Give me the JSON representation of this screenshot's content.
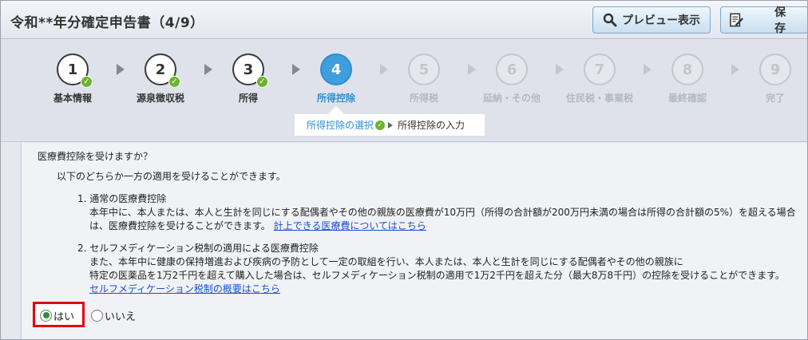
{
  "header": {
    "title": "令和**年分確定申告書（4/9）",
    "preview_label": "プレビュー表示",
    "save_label": "保存"
  },
  "steps": [
    {
      "number": "1",
      "label": "基本情報",
      "state": "done"
    },
    {
      "number": "2",
      "label": "源泉徴収税",
      "state": "done"
    },
    {
      "number": "3",
      "label": "所得",
      "state": "done"
    },
    {
      "number": "4",
      "label": "所得控除",
      "state": "current"
    },
    {
      "number": "5",
      "label": "所得税",
      "state": "future"
    },
    {
      "number": "6",
      "label": "延納・その他",
      "state": "future"
    },
    {
      "number": "7",
      "label": "住民税・事業税",
      "state": "future"
    },
    {
      "number": "8",
      "label": "最終確認",
      "state": "future"
    },
    {
      "number": "9",
      "label": "完了",
      "state": "future"
    }
  ],
  "substeps": {
    "done": "所得控除の選択",
    "current": "所得控除の入力"
  },
  "content": {
    "question": "医療費控除を受けますか？",
    "intro": "以下のどちらか一方の適用を受けることができます。",
    "option1": {
      "title": "1. 通常の医療費控除",
      "body": "本年中に、本人または、本人と生計を同じにする配偶者やその他の親族の医療費が10万円（所得の合計額が200万円未満の場合は所得の合計額の5%）を超える場合は、医療費控除を受けることができます。",
      "link": "計上できる医療費についてはこちら"
    },
    "option2": {
      "title": "2. セルフメディケーション税制の適用による医療費控除",
      "line1": "また、本年中に健康の保持増進および疾病の予防として一定の取組を行い、本人または、本人と生計を同じにする配偶者やその他の親族に",
      "line2": "特定の医薬品を1万2千円を超えて購入した場合は、セルフメディケーション税制の適用で1万2千円を超えた分（最大8万8千円）の控除を受けることができます。",
      "link": "セルフメディケーション税制の概要はこちら"
    }
  },
  "answer": {
    "yes_label": "はい",
    "no_label": "いいえ",
    "selected": "yes"
  },
  "colors": {
    "accent": "#3d9fdc",
    "check": "#6cb32e",
    "highlight": "#e3000f",
    "link": "#1a4fd0"
  }
}
